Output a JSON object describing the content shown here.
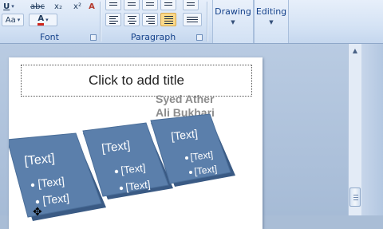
{
  "ribbon": {
    "font_group": {
      "label": "Font",
      "row1": [
        {
          "name": "underline-button",
          "text": "U"
        },
        {
          "name": "strikethrough-button",
          "text": "abc"
        },
        {
          "name": "subscript-button",
          "text": "x₂"
        },
        {
          "name": "superscript-button",
          "text": "x²"
        },
        {
          "name": "clear-formatting-button",
          "text": "A"
        }
      ],
      "row2": [
        {
          "name": "change-case-button",
          "text": "Aa"
        },
        {
          "name": "font-color-button",
          "text": "A"
        }
      ]
    },
    "paragraph_group": {
      "label": "Paragraph"
    },
    "drawing": {
      "label": "Drawing"
    },
    "editing": {
      "label": "Editing"
    }
  },
  "slide": {
    "title_placeholder": "Click to add title",
    "author_line1": "Syed Ather",
    "author_line2": "Ali Bukhari",
    "shapes": [
      {
        "heading": "[Text]",
        "bullets": [
          "[Text]",
          "[Text]"
        ]
      },
      {
        "heading": "[Text]",
        "bullets": [
          "[Text]",
          "[Text]"
        ]
      },
      {
        "heading": "[Text]",
        "bullets": [
          "[Text]",
          "[Text]"
        ]
      }
    ]
  },
  "colors": {
    "shape_fill": "#5b7fab",
    "shape_side": "#3a5a84",
    "ribbon_text": "#15428b"
  }
}
